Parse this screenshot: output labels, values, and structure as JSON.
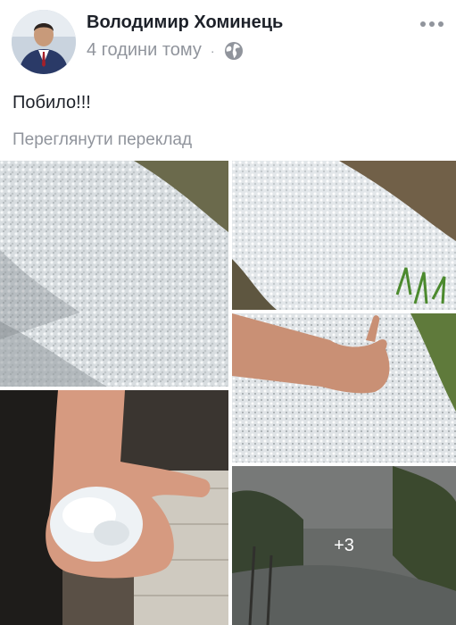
{
  "post": {
    "author": "Володимир Хоминець",
    "time": "4 години тому",
    "separator": "·",
    "privacy_icon": "globe-icon",
    "more_icon": "more-dots-icon",
    "text": "Побило!!!",
    "translate_link": "Переглянути переклад"
  },
  "gallery": {
    "photos": [
      {
        "name": "hail-on-ground-photo"
      },
      {
        "name": "hail-and-grass-photo"
      },
      {
        "name": "hand-over-hail-photo"
      },
      {
        "name": "hand-holding-hailstones-photo"
      },
      {
        "name": "hailstorm-street-photo"
      }
    ],
    "more_count": "+3"
  }
}
